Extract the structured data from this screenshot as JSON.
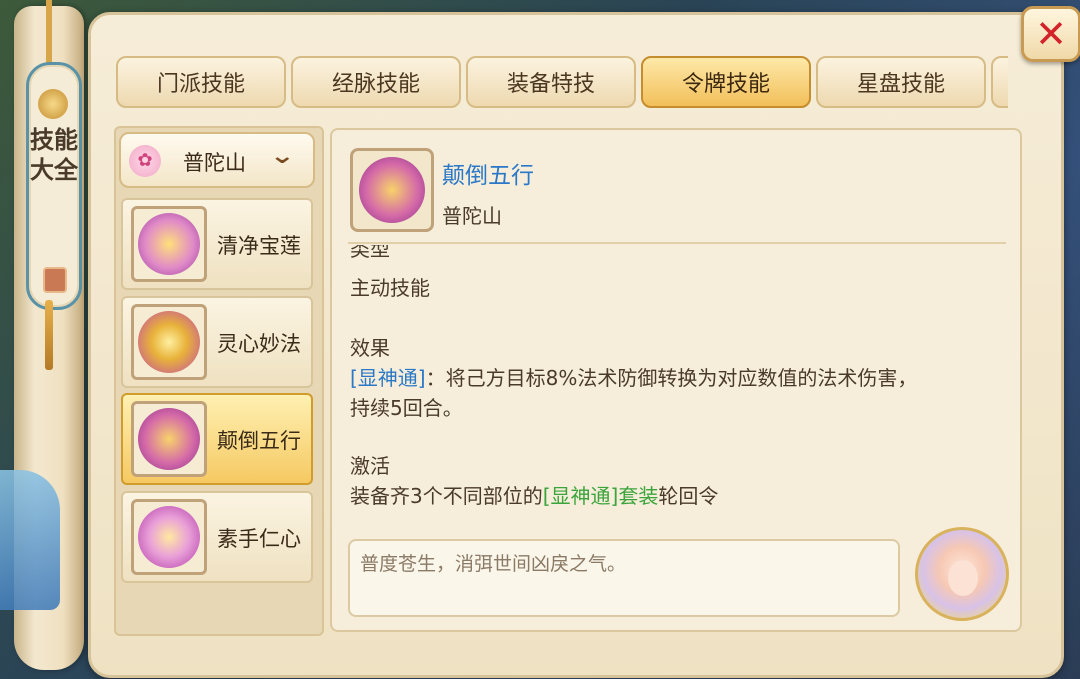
{
  "sidebar": {
    "title": "技能大全"
  },
  "tabs": [
    {
      "label": "门派技能",
      "active": false
    },
    {
      "label": "经脉技能",
      "active": false
    },
    {
      "label": "装备特技",
      "active": false
    },
    {
      "label": "令牌技能",
      "active": true
    },
    {
      "label": "星盘技能",
      "active": false
    }
  ],
  "school_select": {
    "value": "普陀山",
    "icon": "lotus-icon"
  },
  "skills": [
    {
      "name": "清净宝莲",
      "icon": "golden-lotus-orb-icon",
      "active": false
    },
    {
      "name": "灵心妙法",
      "icon": "golden-flower-orb-icon",
      "active": false
    },
    {
      "name": "颠倒五行",
      "icon": "five-elements-orb-icon",
      "active": true
    },
    {
      "name": "素手仁心",
      "icon": "golden-hand-orb-icon",
      "active": false
    }
  ],
  "detail": {
    "title": "颠倒五行",
    "school": "普陀山",
    "type_header": "类型",
    "type_value": "主动技能",
    "effect_header": "效果",
    "effect_tag": "[显神通]",
    "effect_text_1": "：将己方目标8%法术防御转换为对应数值的法术伤害，",
    "effect_text_2": "持续5回合。",
    "activate_header": "激活",
    "activate_pre": "装备齐3个不同部位的",
    "activate_set": "[显神通]套装",
    "activate_post": "轮回令"
  },
  "quote": "普度苍生，消弭世间凶戾之气。",
  "close": "✕",
  "colors": {
    "accent_blue": "#2a78c7",
    "set_green": "#3ba43b",
    "close_red": "#d2232a"
  }
}
